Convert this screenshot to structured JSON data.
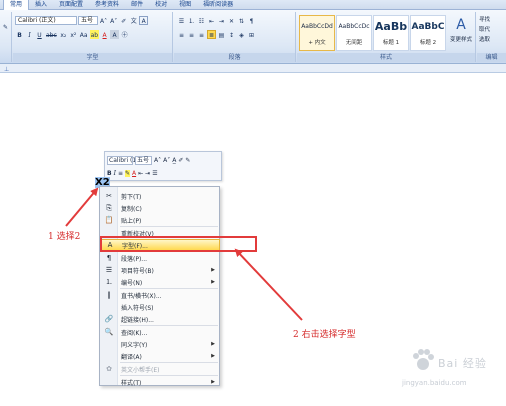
{
  "ribbon": {
    "tabs": [
      {
        "label": "常用"
      },
      {
        "label": "插入"
      },
      {
        "label": "页面配置"
      },
      {
        "label": "参考资料"
      },
      {
        "label": "邮件"
      },
      {
        "label": "校对"
      },
      {
        "label": "视图"
      },
      {
        "label": "福昕阅读器"
      }
    ],
    "font_name": "Calibri (正文)",
    "font_size": "五号",
    "groups": {
      "font": "字型",
      "paragraph": "段落",
      "styles": "样式",
      "editing": "编辑"
    },
    "styles": [
      {
        "sample": "AaBbCcDd",
        "name": "+ 内文"
      },
      {
        "sample": "AaBbCcDc",
        "name": "无间距"
      },
      {
        "sample": "AaBb",
        "name": "标题 1"
      },
      {
        "sample": "AaBbC",
        "name": "标题 2"
      }
    ],
    "change_styles": "变更样式",
    "editing_items": [
      "寻找",
      "取代",
      "选取"
    ]
  },
  "mini_toolbar": {
    "font_name": "Calibri (1",
    "font_size": "五号"
  },
  "selected_text": "X2",
  "context_menu": {
    "items": [
      {
        "label": "剪下(T)",
        "icon": "scissors-icon",
        "disabled": false,
        "submenu": false
      },
      {
        "label": "复制(C)",
        "icon": "copy-icon",
        "disabled": false,
        "submenu": false
      },
      {
        "label": "贴上(P)",
        "icon": "paste-icon",
        "disabled": false,
        "submenu": false
      },
      {
        "label": "重新校对(V)",
        "icon": "",
        "disabled": false,
        "submenu": false
      },
      {
        "label": "字型(F)...",
        "icon": "font-icon",
        "disabled": false,
        "submenu": false,
        "highlighted": true
      },
      {
        "label": "段落(P)...",
        "icon": "paragraph-icon",
        "disabled": false,
        "submenu": false
      },
      {
        "label": "项目符号(B)",
        "icon": "bullets-icon",
        "disabled": false,
        "submenu": true
      },
      {
        "label": "编号(N)",
        "icon": "numbering-icon",
        "disabled": false,
        "submenu": true
      },
      {
        "label": "直书/横书(X)...",
        "icon": "text-direction-icon",
        "disabled": false,
        "submenu": false
      },
      {
        "label": "插入符号(S)",
        "icon": "",
        "disabled": false,
        "submenu": false
      },
      {
        "label": "超链接(H)...",
        "icon": "hyperlink-icon",
        "disabled": false,
        "submenu": false
      },
      {
        "label": "查阅(K)...",
        "icon": "lookup-icon",
        "disabled": false,
        "submenu": false
      },
      {
        "label": "同义字(Y)",
        "icon": "",
        "disabled": false,
        "submenu": true
      },
      {
        "label": "翻译(A)",
        "icon": "",
        "disabled": false,
        "submenu": true
      },
      {
        "label": "英文小帮手(E)",
        "icon": "helper-icon",
        "disabled": true,
        "submenu": false
      },
      {
        "label": "样式(T)",
        "icon": "",
        "disabled": false,
        "submenu": true
      }
    ]
  },
  "annotations": {
    "step1": "1 选择2",
    "step2": "2 右击选择字型"
  },
  "watermark": {
    "brand": "Bai 经验",
    "url": "jingyan.baidu.com"
  },
  "colors": {
    "highlight": "#ffd94f",
    "annotation_red": "#d52b2b",
    "selection": "#9cc4f2"
  }
}
